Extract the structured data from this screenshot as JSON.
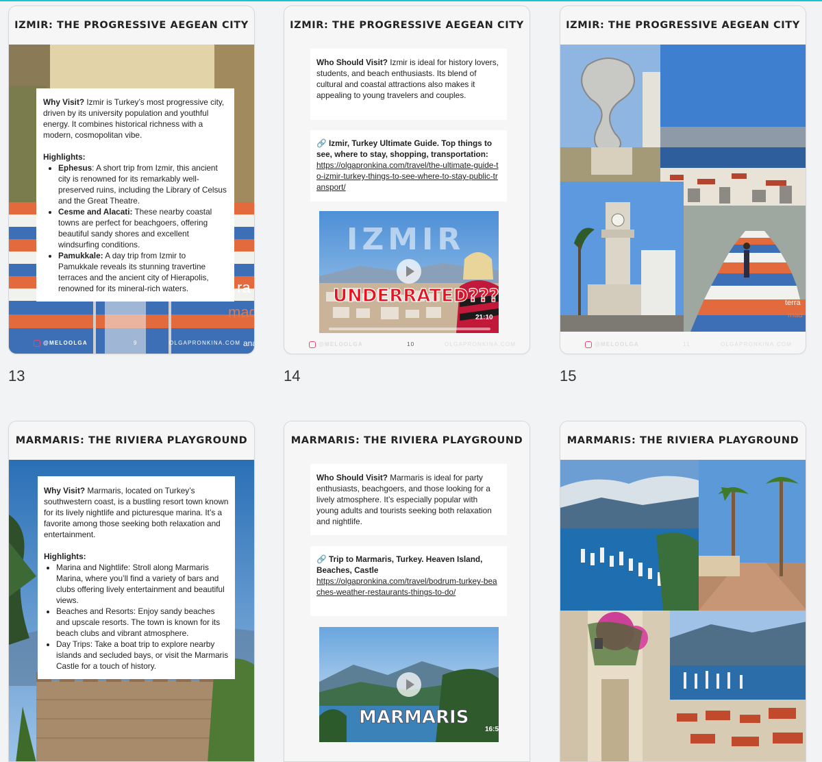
{
  "pages": [
    {
      "number": "13",
      "title": "IZMIR: THE PROGRESSIVE AEGEAN CITY",
      "why_label": "Why Visit?",
      "why_text": " Izmir is Turkey’s most progressive city, driven by its university population and youthful energy. It combines historical richness with a modern, cosmopolitan vibe.",
      "highlights_label": "Highlights:",
      "highlights": [
        {
          "name": "Ephesus",
          "sep": ":",
          "text": " A short trip from Izmir, this ancient city is renowned for its remarkably well-preserved ruins, including the Library of Celsus and the Great Theatre."
        },
        {
          "name": "Cesme and Alacati:",
          "sep": "",
          "text": " These nearby coastal towns are perfect for beachgoers, offering beautiful sandy shores and excellent windsurfing conditions."
        },
        {
          "name": "Pamukkale:",
          "sep": "",
          "text": " A day trip from Izmir to Pamukkale reveals its stunning travertine terraces and the ancient city of Hierapolis, renowned for its mineral-rich waters."
        }
      ],
      "footer_left": "@MELOOLGA",
      "footer_mid": "9",
      "footer_right": "OLGAPRONKINA.COM",
      "bg_text_a": "ra",
      "bg_text_b": "mad",
      "bg_text_c": "ana"
    },
    {
      "number": "14",
      "title": "IZMIR: THE PROGRESSIVE AEGEAN CITY",
      "who_label": "Who Should Visit?",
      "who_text": " Izmir is ideal for history lovers, students, and beach enthusiasts. Its blend of cultural and coastal attractions also makes it appealing to young travelers and couples.",
      "link_icon": "🔗",
      "link_title": "Izmir, Turkey Ultimate Guide. Top things to see, where to stay, shopping, transportation:",
      "link_url": "https://olgapronkina.com/travel/the-ultimate-guide-to-izmir-turkey-things-to-see-where-to-stay-public-transport/",
      "video_title": "IZMIR",
      "video_caption": "UNDERRATED???",
      "video_time": "21:10",
      "footer_left": "@MELOOLGA",
      "footer_mid": "10",
      "footer_right": "OLGAPRONKINA.COM"
    },
    {
      "number": "15",
      "title": "IZMIR: THE PROGRESSIVE AEGEAN CITY",
      "footer_left": "@MELOOLGA",
      "footer_mid": "11",
      "footer_right": "OLGAPRONKINA.COM",
      "photo_text_a": "terra",
      "photo_text_b": "mad"
    },
    {
      "title": "MARMARIS: THE RIVIERA PLAYGROUND",
      "why_label": "Why Visit?",
      "why_text": " Marmaris, located on Turkey’s southwestern coast, is a bustling resort town known for its lively nightlife and picturesque marina. It’s a favorite among those seeking both relaxation and entertainment.",
      "highlights_label": "Highlights:",
      "highlights": [
        "Marina and Nightlife: Stroll along Marmaris Marina, where you’ll find a variety of bars and clubs offering lively entertainment and beautiful views.",
        "Beaches and Resorts: Enjoy sandy beaches and upscale resorts. The town is known for its beach clubs and vibrant atmosphere.",
        "Day Trips: Take a boat trip to explore nearby islands and secluded bays, or visit the Marmaris Castle for a touch of history."
      ]
    },
    {
      "title": "MARMARIS: THE RIVIERA PLAYGROUND",
      "who_label": "Who Should Visit?",
      "who_text": " Marmaris is ideal for party enthusiasts, beachgoers, and those looking for a lively atmosphere. It’s especially popular with young adults and tourists seeking both relaxation and nightlife.",
      "link_icon": "🔗",
      "link_title": "Trip to Marmaris, Turkey. Heaven Island, Beaches, Castle",
      "link_url": "https://olgapronkina.com/travel/bodrum-turkey-beaches-weather-restaurants-things-to-do/",
      "video_title": "MARMARIS",
      "video_time": "16:5"
    },
    {
      "title": "MARMARIS: THE RIVIERA PLAYGROUND"
    }
  ],
  "colors": {
    "accent_line": "#19c3d6",
    "instagram": "#e84872"
  }
}
